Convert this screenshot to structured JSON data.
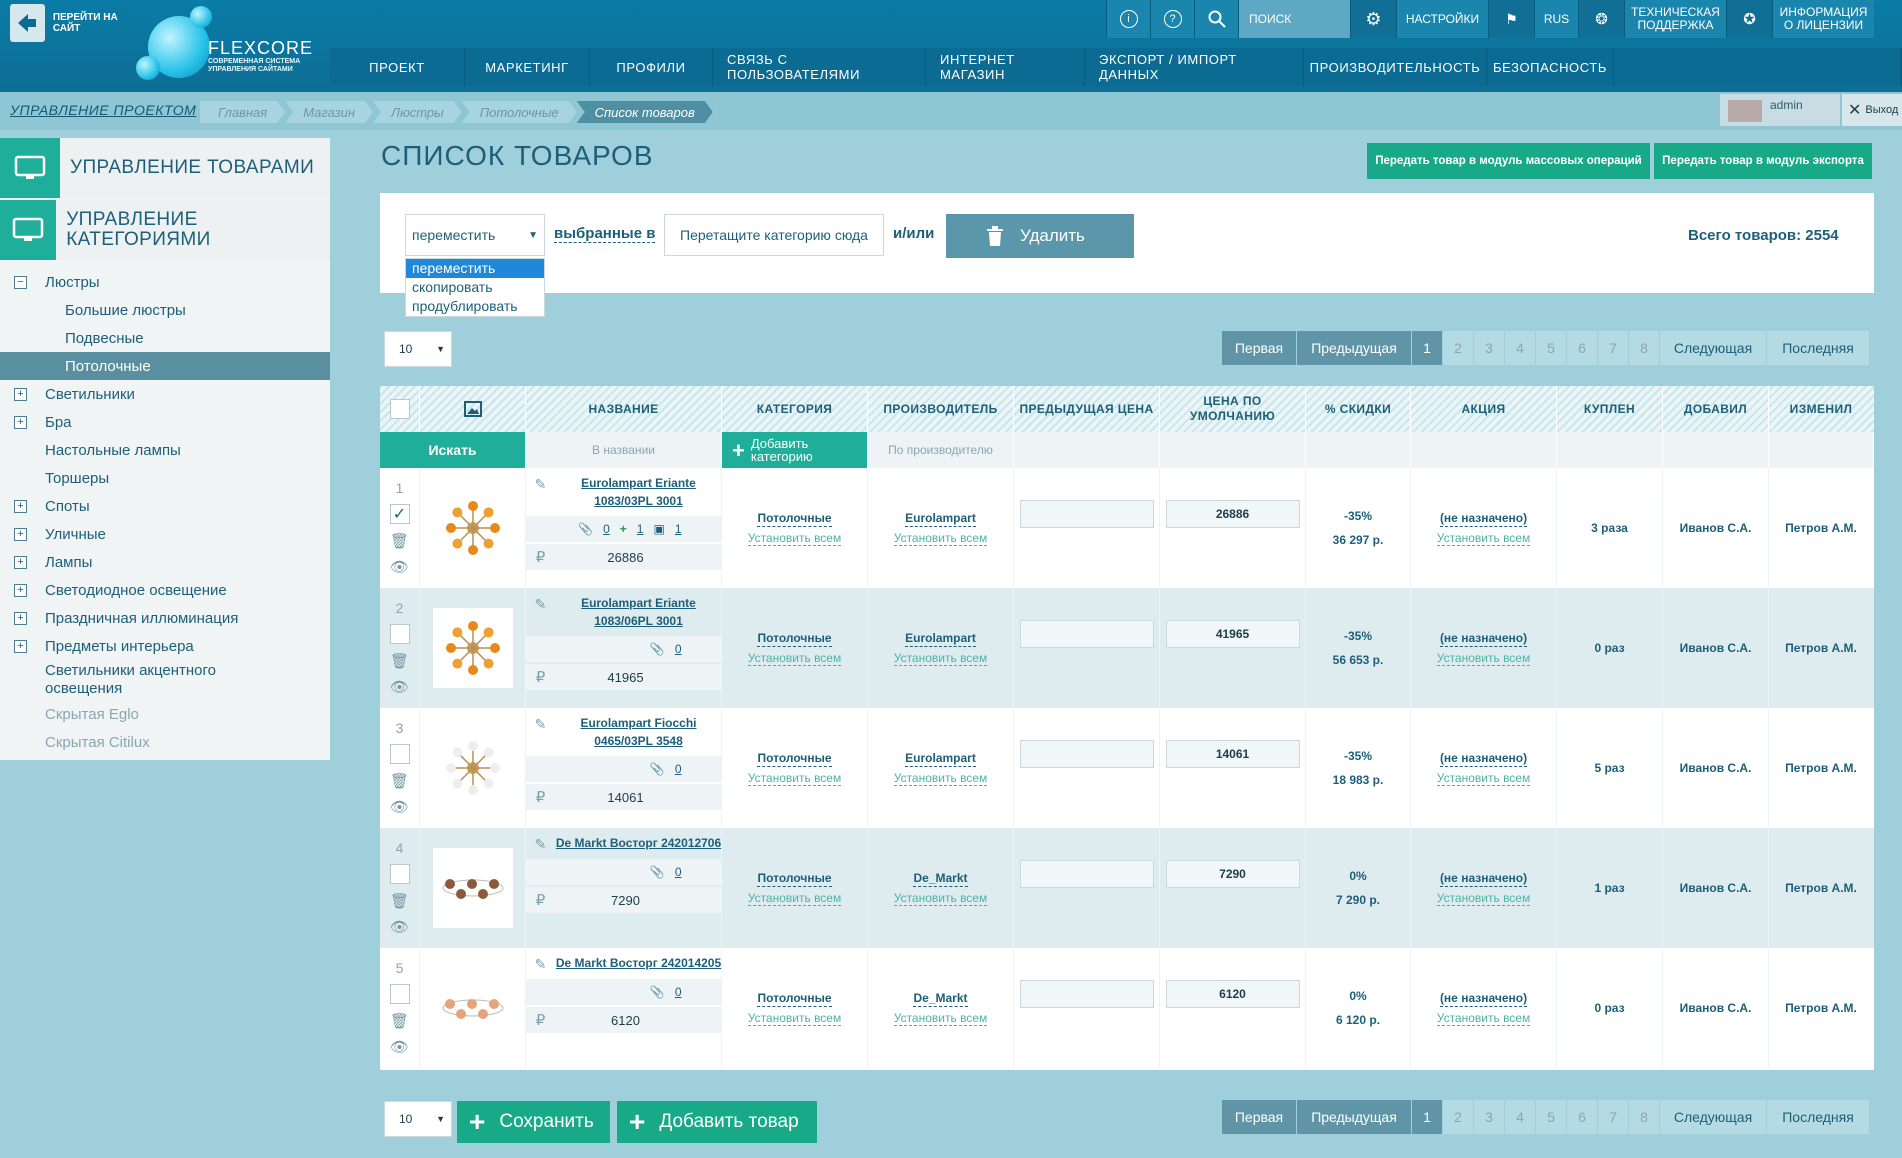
{
  "header": {
    "go_site": "ПЕРЕЙТИ НА САЙТ",
    "logo_name": "FLEXCORE",
    "logo_sub": "СОВРЕМЕННАЯ СИСТЕМА УПРАВЛЕНИЯ САЙТАМИ",
    "search_placeholder": "ПОИСК",
    "settings": "НАСТРОЙКИ",
    "lang": "RUS",
    "support": "ТЕХНИЧЕСКАЯ ПОДДЕРЖКА",
    "license": "ИНФОРМАЦИЯ О ЛИЦЕНЗИИ"
  },
  "nav": [
    "ПРОЕКТ",
    "МАРКЕТИНГ",
    "ПРОФИЛИ",
    "СВЯЗЬ С ПОЛЬЗОВАТЕЛЯМИ",
    "ИНТЕРНЕТ МАГАЗИН",
    "ЭКСПОРТ / ИМПОРТ ДАННЫХ",
    "ПРОИЗВОДИТЕЛЬНОСТЬ",
    "БЕЗОПАСНОСТЬ"
  ],
  "breadcrumb": {
    "project": "УПРАВЛЕНИЕ ПРОЕКТОМ",
    "items": [
      "Главная",
      "Магазин",
      "Люстры",
      "Потолочные",
      "Список товаров"
    ]
  },
  "user": {
    "name": "admin",
    "logout": "Выход"
  },
  "sidebar": {
    "headers": [
      "УПРАВЛЕНИЕ ТОВАРАМИ",
      "УПРАВЛЕНИЕ КАТЕГОРИЯМИ"
    ],
    "tree": [
      {
        "label": "Люстры",
        "level": 0,
        "toggle": "−"
      },
      {
        "label": "Большие люстры",
        "level": 1
      },
      {
        "label": "Подвесные",
        "level": 1
      },
      {
        "label": "Потолочные",
        "level": 1,
        "selected": true
      },
      {
        "label": "Светильники",
        "level": 0,
        "toggle": "+"
      },
      {
        "label": "Бра",
        "level": 0,
        "toggle": "+"
      },
      {
        "label": "Настольные лампы",
        "level": 0
      },
      {
        "label": "Торшеры",
        "level": 0
      },
      {
        "label": "Споты",
        "level": 0,
        "toggle": "+"
      },
      {
        "label": "Уличные",
        "level": 0,
        "toggle": "+"
      },
      {
        "label": "Лампы",
        "level": 0,
        "toggle": "+"
      },
      {
        "label": "Светодиодное освещение",
        "level": 0,
        "toggle": "+"
      },
      {
        "label": "Праздничная иллюминация",
        "level": 0,
        "toggle": "+"
      },
      {
        "label": "Предметы интерьера",
        "level": 0,
        "toggle": "+"
      },
      {
        "label": "Светильники акцентного освещения",
        "level": 0,
        "multiline": true
      },
      {
        "label": "Скрытая Eglo",
        "level": 0,
        "dim": true
      },
      {
        "label": "Скрытая Citilux",
        "level": 0,
        "dim": true
      }
    ]
  },
  "page": {
    "title": "СПИСОК ТОВАРОВ",
    "btn_mass": "Передать товар в модуль массовых операций",
    "btn_export": "Передать товар в модуль экспорта"
  },
  "actions": {
    "selected_action": "переместить",
    "options": [
      "переместить",
      "скопировать",
      "продублировать"
    ],
    "selected_label": "выбранные в",
    "drop_hint": "Перетащите категорию сюда",
    "andor": "и/или",
    "delete": "Удалить",
    "total": "Всего товаров: 2554"
  },
  "pager": {
    "per_page": "10",
    "first": "Первая",
    "prev": "Предыдущая",
    "pages": [
      "1",
      "2",
      "3",
      "4",
      "5",
      "6",
      "7",
      "8"
    ],
    "next": "Следующая",
    "last": "Последняя"
  },
  "table": {
    "columns": [
      "НАЗВАНИЕ",
      "КАТЕГОРИЯ",
      "ПРОИЗВОДИТЕЛЬ",
      "ПРЕДЫДУЩАЯ ЦЕНА",
      "ЦЕНА ПО УМОЛЧАНИЮ",
      "% СКИДКИ",
      "АКЦИЯ",
      "КУПЛЕН",
      "ДОБАВИЛ",
      "ИЗМЕНИЛ"
    ],
    "search_btn": "Искать",
    "filter_name": "В названии",
    "add_category": "Добавить категорию",
    "filter_maker": "По производителю",
    "set_all": "Установить всем",
    "rows": [
      {
        "n": "1",
        "checked": true,
        "name": "Eurolampart Eriante 1083/03PL 3001",
        "files": "0",
        "adds": "1",
        "pics": "1",
        "price": "26886",
        "category": "Потолочные",
        "maker": "Eurolampart",
        "prev": "",
        "def": "26886",
        "disc": "-35%",
        "final": "36 297 р.",
        "promo": "(не назначено)",
        "bought": "3 раза",
        "added": "Иванов С.А.",
        "changed": "Петров А.М.",
        "alt": false
      },
      {
        "n": "2",
        "checked": false,
        "name": "Eurolampart Eriante 1083/06PL 3001",
        "files": "0",
        "price": "41965",
        "category": "Потолочные",
        "maker": "Eurolampart",
        "prev": "",
        "def": "41965",
        "disc": "-35%",
        "final": "56 653 р.",
        "promo": "(не назначено)",
        "bought": "0 раз",
        "added": "Иванов С.А.",
        "changed": "Петров А.М.",
        "alt": true
      },
      {
        "n": "3",
        "checked": false,
        "name": "Eurolampart Fiocchi 0465/03PL 3548",
        "files": "0",
        "price": "14061",
        "category": "Потолочные",
        "maker": "Eurolampart",
        "prev": "",
        "def": "14061",
        "disc": "-35%",
        "final": "18 983 р.",
        "promo": "(не назначено)",
        "bought": "5 раз",
        "added": "Иванов С.А.",
        "changed": "Петров А.М.",
        "alt": false
      },
      {
        "n": "4",
        "checked": false,
        "name": "De Markt Восторг 242012706",
        "files": "0",
        "price": "7290",
        "category": "Потолочные",
        "maker": "De_Markt",
        "prev": "",
        "def": "7290",
        "disc": "0%",
        "final": "7 290 р.",
        "promo": "(не назначено)",
        "bought": "1 раз",
        "added": "Иванов С.А.",
        "changed": "Петров А.М.",
        "alt": true
      },
      {
        "n": "5",
        "checked": false,
        "name": "De Markt Восторг 242014205",
        "files": "0",
        "price": "6120",
        "category": "Потолочные",
        "maker": "De_Markt",
        "prev": "",
        "def": "6120",
        "disc": "0%",
        "final": "6 120 р.",
        "promo": "(не назначено)",
        "bought": "0 раз",
        "added": "Иванов С.А.",
        "changed": "Петров А.М.",
        "alt": false
      }
    ]
  },
  "bottom": {
    "save": "Сохранить",
    "add": "Добавить товар"
  },
  "colors": {
    "accent": "#17a988",
    "header": "#0c6b92",
    "bg": "#9fcfda"
  }
}
